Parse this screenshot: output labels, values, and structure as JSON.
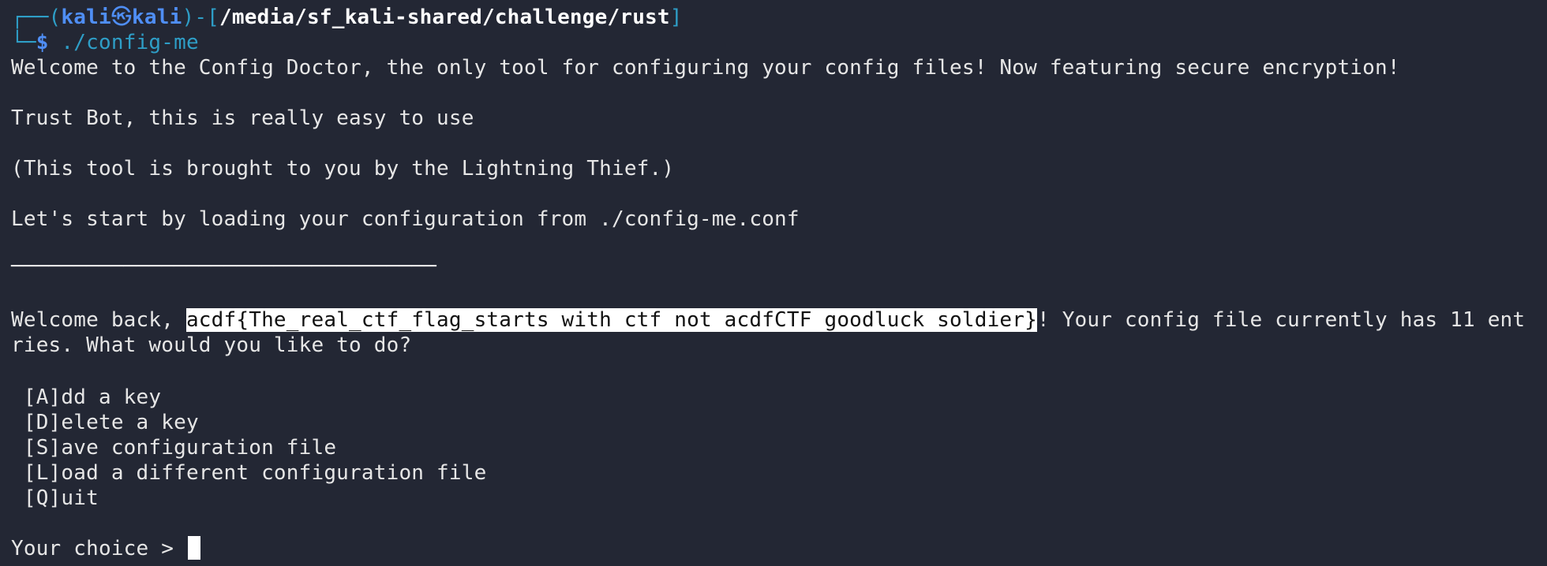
{
  "prompt": {
    "frame_top_left": "┌──(",
    "user": "kali",
    "at_symbol": "㉿",
    "host": "kali",
    "frame_mid": ")-[",
    "path": "/media/sf_kali-shared/challenge/rust",
    "frame_end": "]",
    "frame_bottom": "└─",
    "dollar": "$",
    "command": " ./config-me"
  },
  "output": {
    "welcome": "Welcome to the Config Doctor, the only tool for configuring your config files! Now featuring secure encryption!",
    "trust": "Trust Bot, this is really easy to use",
    "credit": "(This tool is brought to you by the Lightning Thief.)",
    "loading": "Let's start by loading your configuration from ./config-me.conf",
    "separator": "──────────────────────────────────",
    "welcome_back_prefix": "Welcome back, ",
    "flag": "acdf{The_real_ctf_flag_starts with ctf not acdfCTF goodluck soldier}",
    "welcome_back_suffix": "! Your config file currently has 11 ent",
    "welcome_back_wrap": "ries. What would you like to do?"
  },
  "menu": {
    "items": [
      " [A]dd a key",
      " [D]elete a key",
      " [S]ave configuration file",
      " [L]oad a different configuration file",
      " [Q]uit"
    ]
  },
  "input": {
    "label": "Your choice > "
  },
  "colors": {
    "background": "#232734",
    "prompt_frame": "#2e9ec7",
    "prompt_user": "#4f8ef5",
    "text": "#e6e6e6",
    "highlight": "#ffffff"
  }
}
